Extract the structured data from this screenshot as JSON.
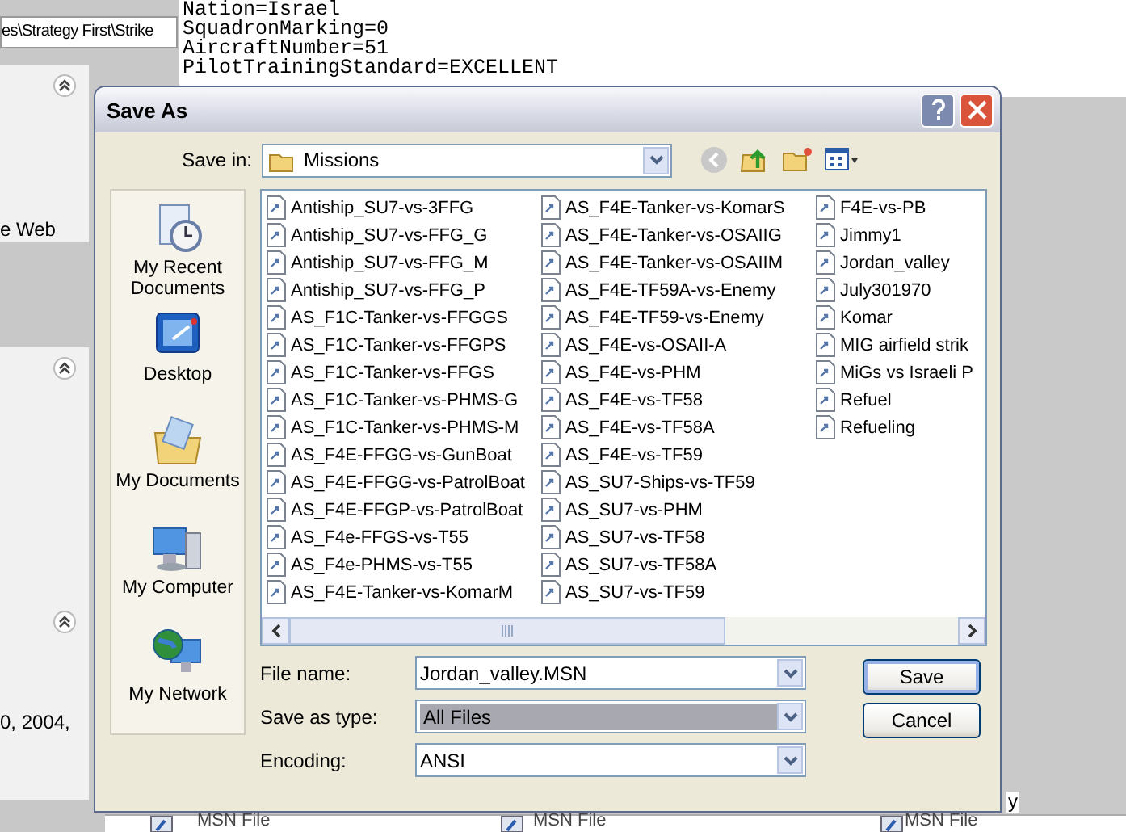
{
  "background": {
    "address_text": "es\\Strategy First\\Strike",
    "notepad_lines": [
      "Nation=Israel",
      "SquadronMarking=0",
      "AircraftNumber=51",
      "PilotTrainingStandard=EXCELLENT"
    ],
    "pane_texts": [
      "e Web",
      "0, 2004,"
    ],
    "status_texts": [
      "MSN File",
      "MSN File",
      "MSN File"
    ],
    "side_text": "y"
  },
  "dialog": {
    "title": "Save As",
    "save_in": {
      "label": "Save in:",
      "value": "Missions"
    },
    "places": [
      {
        "label": "My Recent Documents",
        "kind": "recent"
      },
      {
        "label": "Desktop",
        "kind": "desktop"
      },
      {
        "label": "My Documents",
        "kind": "documents"
      },
      {
        "label": "My Computer",
        "kind": "computer"
      },
      {
        "label": "My Network",
        "kind": "network"
      }
    ],
    "files": [
      "Antiship_SU7-vs-3FFG",
      "Antiship_SU7-vs-FFG_G",
      "Antiship_SU7-vs-FFG_M",
      "Antiship_SU7-vs-FFG_P",
      "AS_F1C-Tanker-vs-FFGGS",
      "AS_F1C-Tanker-vs-FFGPS",
      "AS_F1C-Tanker-vs-FFGS",
      "AS_F1C-Tanker-vs-PHMS-G",
      "AS_F1C-Tanker-vs-PHMS-M",
      "AS_F4E-FFGG-vs-GunBoat",
      "AS_F4E-FFGG-vs-PatrolBoat",
      "AS_F4E-FFGP-vs-PatrolBoat",
      "AS_F4e-FFGS-vs-T55",
      "AS_F4e-PHMS-vs-T55",
      "AS_F4E-Tanker-vs-KomarM",
      "AS_F4E-Tanker-vs-KomarS",
      "AS_F4E-Tanker-vs-OSAIIG",
      "AS_F4E-Tanker-vs-OSAIIM",
      "AS_F4E-TF59A-vs-Enemy",
      "AS_F4E-TF59-vs-Enemy",
      "AS_F4E-vs-OSAII-A",
      "AS_F4E-vs-PHM",
      "AS_F4E-vs-TF58",
      "AS_F4E-vs-TF58A",
      "AS_F4E-vs-TF59",
      "AS_SU7-Ships-vs-TF59",
      "AS_SU7-vs-PHM",
      "AS_SU7-vs-TF58",
      "AS_SU7-vs-TF58A",
      "AS_SU7-vs-TF59",
      "F4E-vs-PB",
      "Jimmy1",
      "Jordan_valley",
      "July301970",
      "Komar",
      "MIG airfield strik",
      "MiGs vs Israeli P",
      "Refuel",
      "Refueling"
    ],
    "fields": [
      {
        "label": "File name:",
        "value": "Jordan_valley.MSN",
        "selected": false
      },
      {
        "label": "Save as type:",
        "value": "All Files",
        "selected": true
      },
      {
        "label": "Encoding:",
        "value": "ANSI",
        "selected": false
      }
    ],
    "buttons": [
      {
        "label": "Save",
        "default": true
      },
      {
        "label": "Cancel",
        "default": false
      }
    ]
  }
}
